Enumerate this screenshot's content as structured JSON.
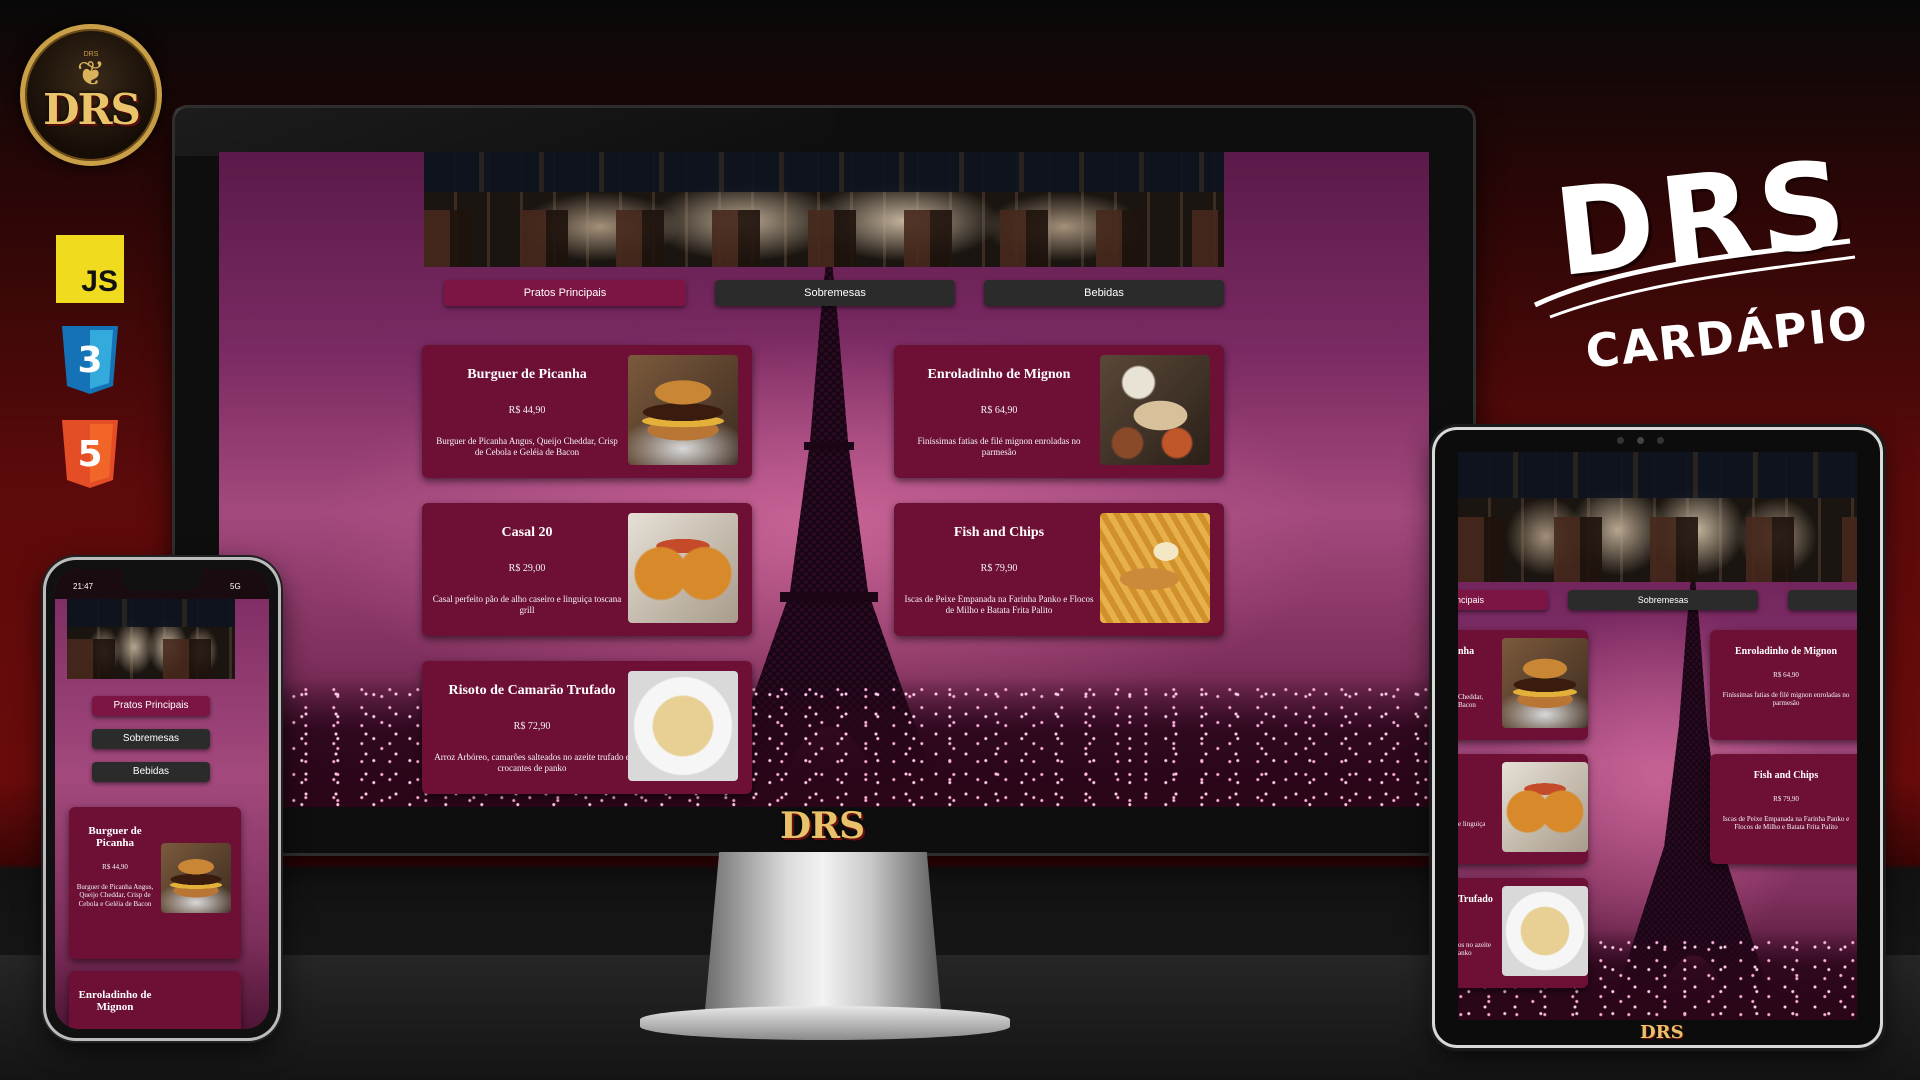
{
  "brand": {
    "badge_text": "DRS",
    "badge_small": "DRS",
    "title": "DRS",
    "subtitle": "CARDÁPIO",
    "monitor_logo": "DRS",
    "tablet_logo": "DRS"
  },
  "tech_badges": [
    {
      "label": "JS",
      "icon": "javascript-icon",
      "color": "#f0db1f"
    },
    {
      "label": "3",
      "icon": "css3-icon",
      "color": "#1572b6"
    },
    {
      "label": "5",
      "icon": "html5-icon",
      "color": "#e44d26"
    }
  ],
  "tabs": [
    {
      "label": "Pratos Principais"
    },
    {
      "label": "Sobremesas"
    },
    {
      "label": "Bebidas"
    }
  ],
  "menu": [
    {
      "name": "Burguer de Picanha",
      "price": "R$ 44,90",
      "desc": "Burguer de Picanha Angus, Queijo Cheddar, Crisp de Cebola e Geléia de Bacon"
    },
    {
      "name": "Enroladinho de Mignon",
      "price": "R$ 64,90",
      "desc": "Finíssimas fatias de filé mignon enroladas no parmesão"
    },
    {
      "name": "Casal 20",
      "price": "R$ 29,00",
      "desc": "Casal perfeito pão de alho caseiro e linguiça toscana grill"
    },
    {
      "name": "Fish and Chips",
      "price": "R$ 79,90",
      "desc": "Iscas de Peixe Empanada na Farinha Panko e Flocos de Milho e Batata Frita Palito"
    },
    {
      "name": "Risoto de Camarão Trufado",
      "price": "R$ 72,90",
      "desc": "Arroz Arbóreo, camarões salteados no azeite trufado e crocantes de panko"
    }
  ],
  "tablet": {
    "tab_left": "ncipais",
    "tab_mid": "Sobremesas",
    "card1_name": "nha",
    "card1_desc_a": "Cheddar,",
    "card1_desc_b": "Bacon",
    "card2_name": "Enroladinho de Mignon",
    "card2_price": "R$ 64,90",
    "card2_desc": "Finíssimas fatias de filé mignon enroladas no parmesão",
    "card3_desc": "e linguiça",
    "card4_name": "Fish and Chips",
    "card4_price": "R$ 79,90",
    "card4_desc": "Iscas de Peixe Empanada na Farinha Panko e Flocos de Milho e Batata Frita Palito",
    "card5_name": "Trufado",
    "card5_desc_a": "os no azeite",
    "card5_desc_b": "anko"
  },
  "phone": {
    "time": "21:47",
    "signal": "5G",
    "tabs": [
      "Pratos Principais",
      "Sobremesas",
      "Bebidas"
    ],
    "card1_name": "Burguer de Picanha",
    "card1_price": "R$ 44,90",
    "card1_desc": "Burguer de Picanha Angus, Queijo Cheddar, Crisp de Cebola e Geléia de Bacon",
    "card2_name": "Enroladinho de Mignon"
  }
}
